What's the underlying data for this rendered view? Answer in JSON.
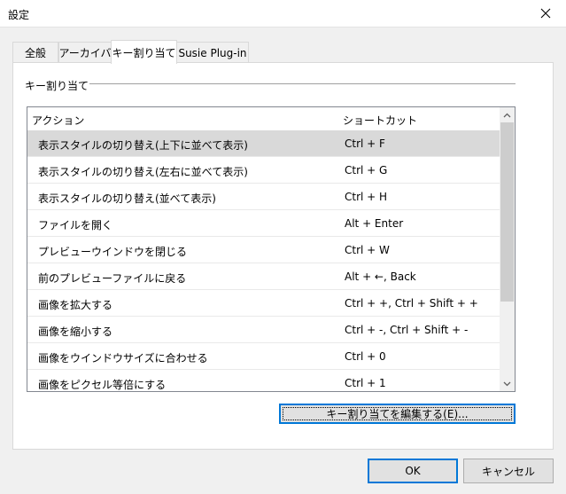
{
  "window": {
    "title": "設定"
  },
  "tabs": [
    {
      "label": "全般"
    },
    {
      "label": "アーカイバ"
    },
    {
      "label": "キー割り当て"
    },
    {
      "label": "Susie Plug-in"
    }
  ],
  "active_tab": "キー割り当て",
  "group": {
    "label": "キー割り当て"
  },
  "table": {
    "headers": {
      "action": "アクション",
      "shortcut": "ショートカット"
    },
    "rows": [
      {
        "action": "表示スタイルの切り替え(上下に並べて表示)",
        "shortcut": "Ctrl + F"
      },
      {
        "action": "表示スタイルの切り替え(左右に並べて表示)",
        "shortcut": "Ctrl + G"
      },
      {
        "action": "表示スタイルの切り替え(並べて表示)",
        "shortcut": "Ctrl + H"
      },
      {
        "action": "ファイルを開く",
        "shortcut": "Alt + Enter"
      },
      {
        "action": "プレビューウインドウを閉じる",
        "shortcut": "Ctrl + W"
      },
      {
        "action": "前のプレビューファイルに戻る",
        "shortcut": "Alt + ←, Back"
      },
      {
        "action": "画像を拡大する",
        "shortcut": "Ctrl + +, Ctrl + Shift + +"
      },
      {
        "action": "画像を縮小する",
        "shortcut": "Ctrl + -, Ctrl + Shift + -"
      },
      {
        "action": "画像をウインドウサイズに合わせる",
        "shortcut": "Ctrl + 0"
      },
      {
        "action": "画像をピクセル等倍にする",
        "shortcut": "Ctrl + 1"
      }
    ],
    "selected_row_index": 0
  },
  "buttons": {
    "edit": "キー割り当てを編集する(E)...",
    "ok": "OK",
    "cancel": "キャンセル"
  },
  "colors": {
    "accent": "#0078d7",
    "selection": "#d9d9d9"
  }
}
